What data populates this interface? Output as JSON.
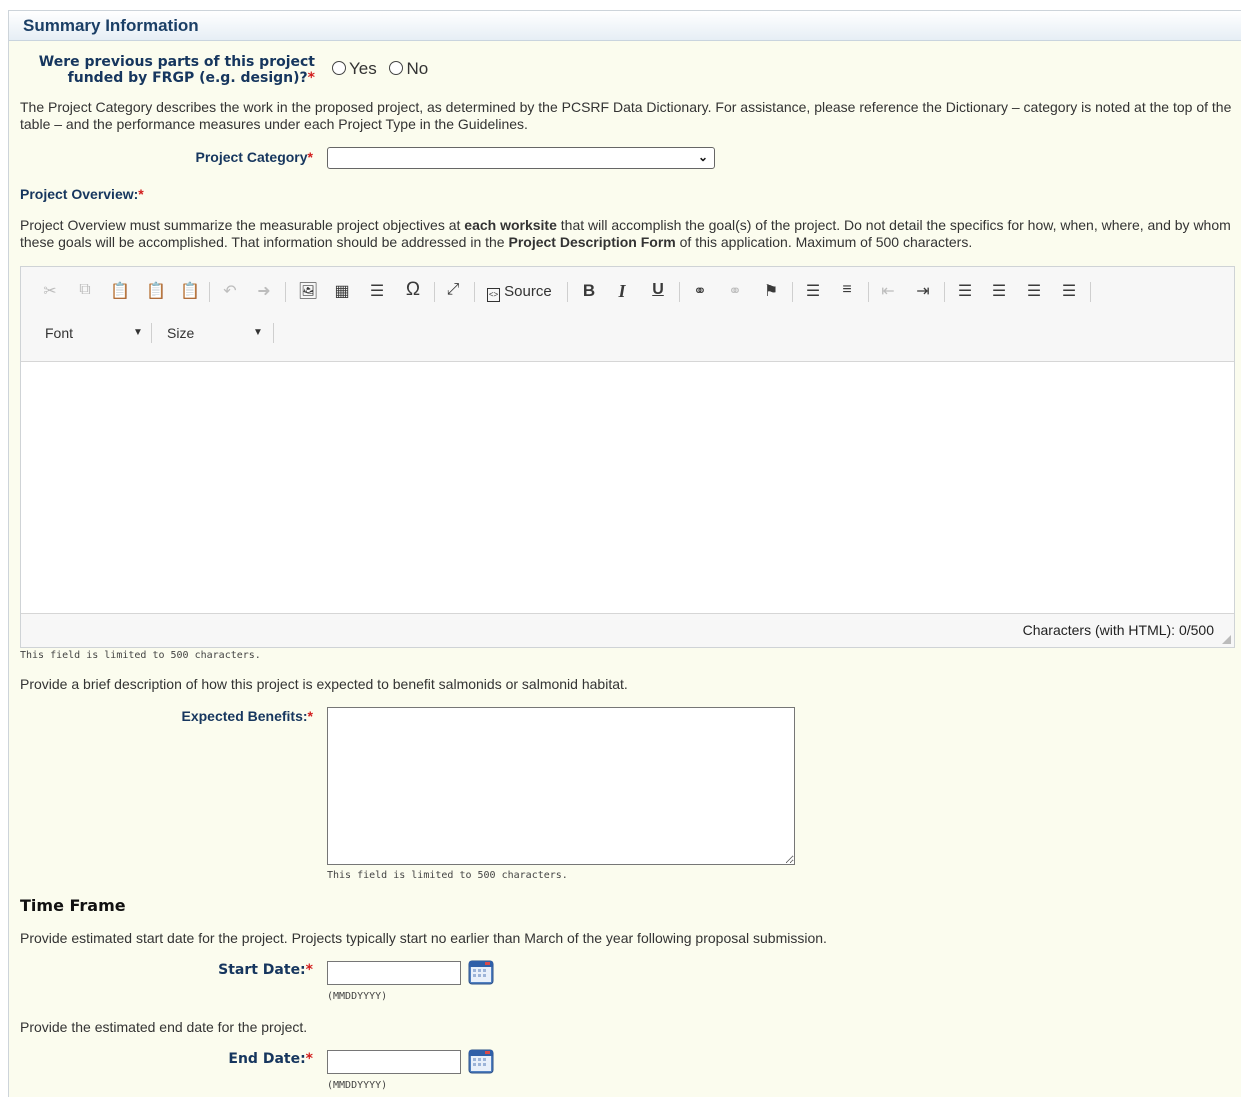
{
  "header": {
    "title": "Summary Information"
  },
  "funding_question": {
    "label_line1": "Were previous parts of this project",
    "label_line2": "funded by FRGP (e.g. design)?",
    "required": "*",
    "options": [
      "Yes",
      "No"
    ]
  },
  "category_help": "The Project Category describes the work in the proposed project, as determined by the PCSRF Data Dictionary. For assistance, please reference the Dictionary – category is noted at the top of the table – and the performance measures under each Project Type in the Guidelines.",
  "project_category": {
    "label": "Project Category",
    "required": "*",
    "selected": ""
  },
  "project_overview": {
    "label": "Project Overview:",
    "required": "*",
    "help_part1": "Project Overview must summarize the measurable project objectives at ",
    "help_bold1": "each worksite",
    "help_part2": " that will accomplish the goal(s) of the project. Do not detail the specifics for how, when, where, and by whom these goals will be accomplished. That information should be addressed in the ",
    "help_bold2": "Project Description Form",
    "help_part3": " of this application. Maximum of 500 characters."
  },
  "editor": {
    "source_label": "Source",
    "font_label": "Font",
    "size_label": "Size",
    "char_count": "Characters (with HTML): 0/500",
    "limit_note": "This field is limited to 500 characters."
  },
  "benefits": {
    "help": "Provide a brief description of how this project is expected to benefit salmonids or salmonid habitat.",
    "label": "Expected Benefits:",
    "required": "*",
    "value": "",
    "limit_note": "This field is limited to 500 characters."
  },
  "time_frame": {
    "title": "Time Frame",
    "start_help": "Provide estimated start date for the project. Projects typically start no earlier than March of the year following proposal submission.",
    "start_label": "Start Date:",
    "end_help": "Provide the estimated end date for the project.",
    "end_label": "End Date:",
    "required": "*",
    "date_format": "(MMDDYYYY)",
    "start_value": "",
    "end_value": ""
  }
}
